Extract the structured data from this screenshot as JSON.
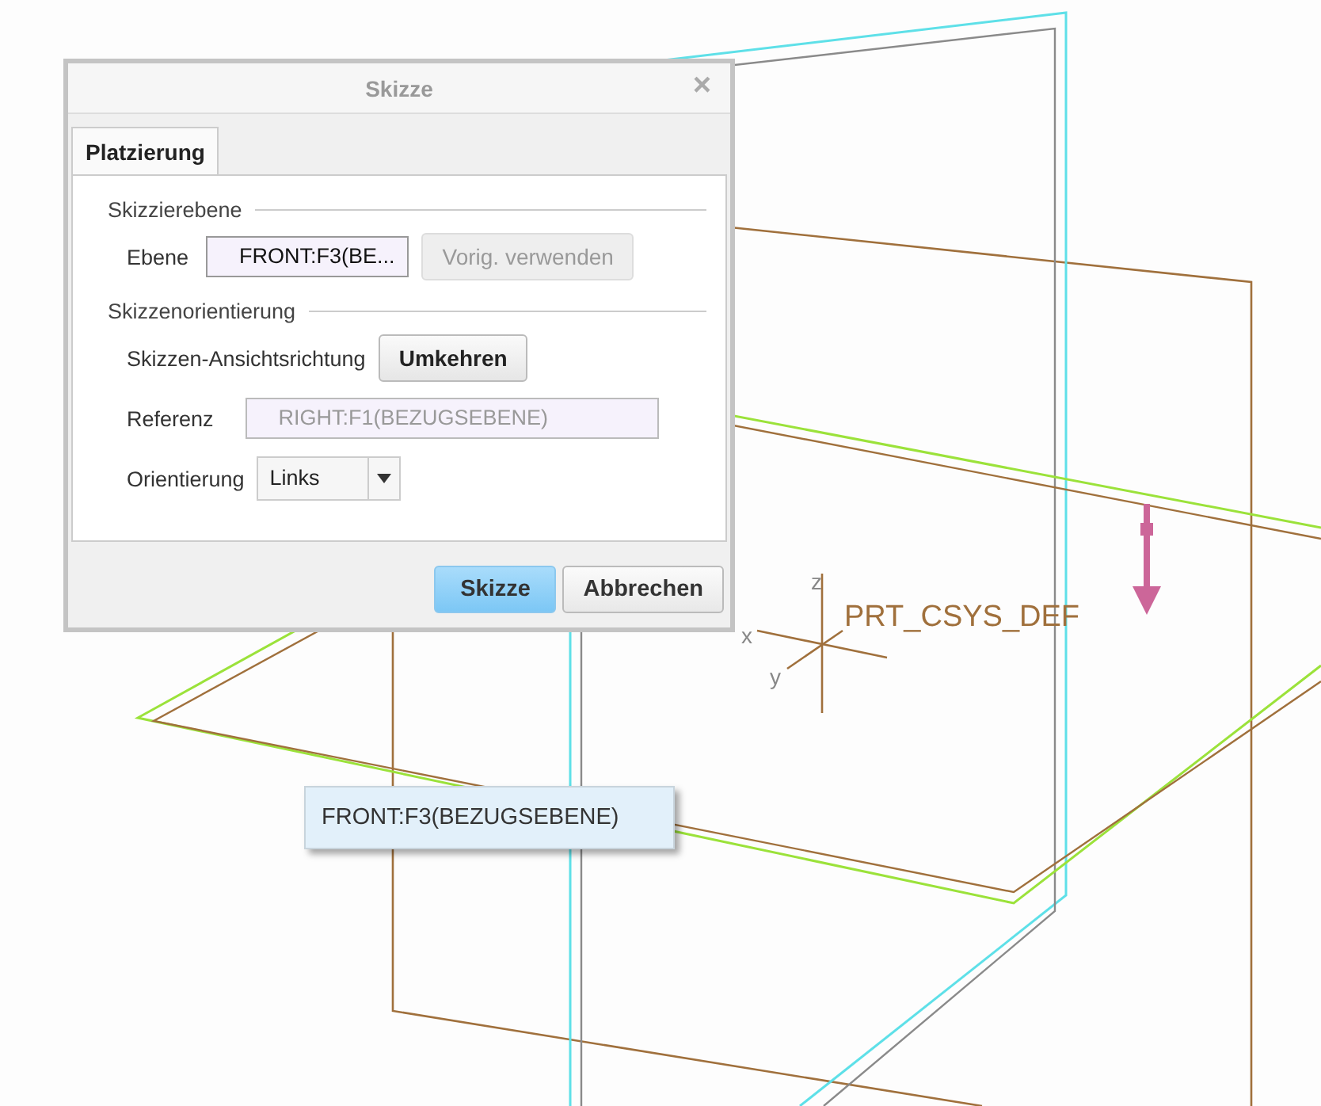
{
  "dialog": {
    "title": "Skizze",
    "close": "×",
    "tabs": [
      {
        "label": "Platzierung",
        "selected": true
      }
    ],
    "sections": [
      {
        "title": "Skizzierebene",
        "rows": [
          {
            "kind": "field",
            "label": "Ebene",
            "value": "FRONT:F3(BE...",
            "disabled": false,
            "button": {
              "label": "Vorig. verwenden",
              "disabled": true
            }
          }
        ]
      },
      {
        "title": "Skizzenorientierung",
        "rows": [
          {
            "kind": "action",
            "label": "Skizzen-Ansichtsrichtung",
            "button": {
              "label": "Umkehren",
              "disabled": false
            }
          },
          {
            "kind": "field",
            "label": "Referenz",
            "value": "RIGHT:F1(BEZUGSEBENE)",
            "disabled": true
          },
          {
            "kind": "select",
            "label": "Orientierung",
            "value": "Links"
          }
        ]
      }
    ],
    "buttons": [
      {
        "label": "Skizze",
        "kind": "primary"
      },
      {
        "label": "Abbrechen",
        "kind": "normal"
      }
    ]
  },
  "viewport": {
    "csys": {
      "label": "PRT_CSYS_DEF",
      "axes": [
        "z",
        "x",
        "y"
      ]
    },
    "tooltip": "FRONT:F3(BEZUGSEBENE)"
  }
}
